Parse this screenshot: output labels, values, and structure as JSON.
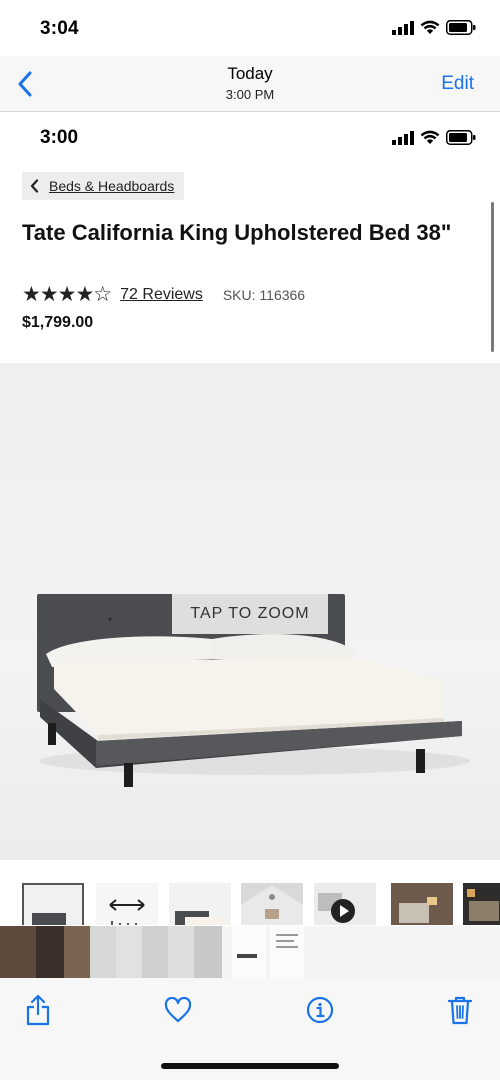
{
  "device_status": {
    "time": "3:04"
  },
  "nav": {
    "title": "Today",
    "subtitle": "3:00 PM",
    "edit_label": "Edit"
  },
  "screenshot": {
    "status_time": "3:00",
    "breadcrumb": {
      "label": "Beds & Headboards"
    },
    "product": {
      "title": "Tate California King Upholstered Bed 38\"",
      "stars": "★★★★☆",
      "rating": 4.5,
      "reviews": "72 Reviews",
      "sku": "SKU: 116366",
      "price": "$1,799.00"
    },
    "hero": {
      "zoom_label": "TAP TO ZOOM"
    },
    "thumbnails": [
      "bed-front",
      "bed-dimensions",
      "bed-side",
      "bed-room-attic",
      "bed-video",
      "bed-room-dark",
      "bed-room-night"
    ]
  },
  "toolbar": {
    "icons": [
      "share-icon",
      "heart-icon",
      "info-icon",
      "trash-icon"
    ]
  },
  "colors": {
    "accent": "#1a73e8",
    "bed_fabric": "#3f4144",
    "mattress": "#f6f3ec"
  }
}
